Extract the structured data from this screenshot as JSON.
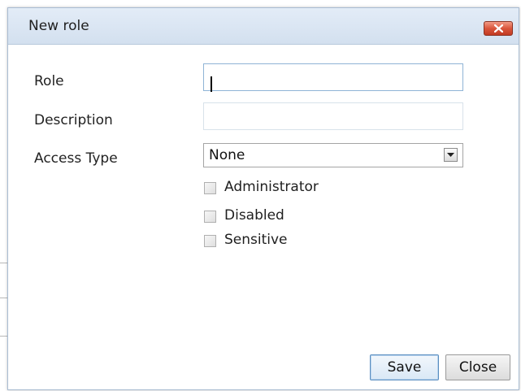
{
  "dialog": {
    "title": "New role",
    "close_icon": "close-x-icon",
    "accent_color": "#d9563c"
  },
  "form": {
    "role": {
      "label": "Role",
      "value": "",
      "placeholder": ""
    },
    "description": {
      "label": "Description",
      "value": "",
      "placeholder": ""
    },
    "access_type": {
      "label": "Access Type",
      "selected": "None"
    },
    "checkboxes": [
      {
        "label": "Administrator",
        "checked": false
      },
      {
        "label": "Disabled",
        "checked": false
      },
      {
        "label": "Sensitive",
        "checked": false
      }
    ]
  },
  "buttons": {
    "save_label": "Save",
    "close_label": "Close"
  }
}
